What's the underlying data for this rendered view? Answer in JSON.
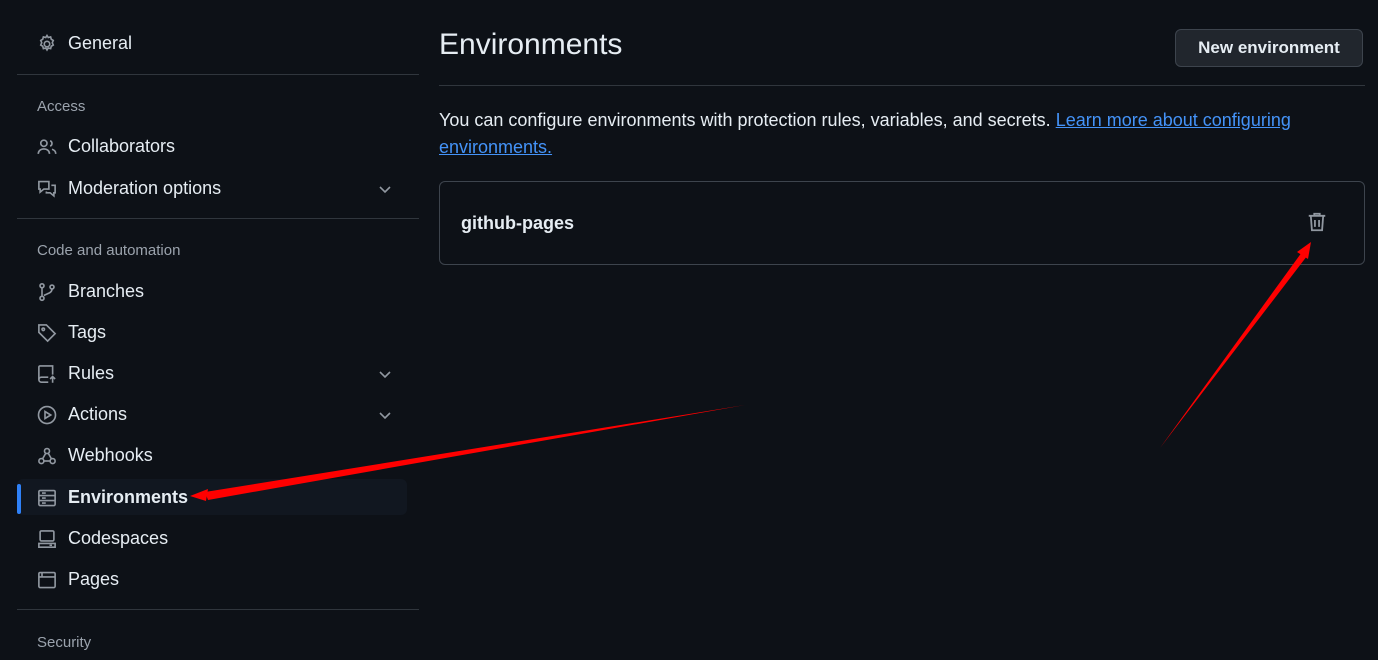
{
  "sidebar": {
    "general": "General",
    "sections": {
      "access": "Access",
      "code_automation": "Code and automation",
      "security": "Security"
    },
    "items": {
      "collaborators": "Collaborators",
      "moderation": "Moderation options",
      "branches": "Branches",
      "tags": "Tags",
      "rules": "Rules",
      "actions": "Actions",
      "webhooks": "Webhooks",
      "environments": "Environments",
      "codespaces": "Codespaces",
      "pages": "Pages"
    },
    "active_item": "Environments"
  },
  "main": {
    "title": "Environments",
    "new_button": "New environment",
    "description": "You can configure environments with protection rules, variables, and secrets.",
    "learn_more_link": "Learn more about configuring environments.",
    "environments": [
      {
        "name": "github-pages"
      }
    ]
  },
  "icons": {
    "general": "gear-icon",
    "collaborators": "people-icon",
    "moderation": "comment-discussion-icon",
    "branches": "git-branch-icon",
    "tags": "tag-icon",
    "rules": "repo-push-icon",
    "actions": "play-icon",
    "webhooks": "webhook-icon",
    "environments": "server-icon",
    "codespaces": "codespaces-icon",
    "pages": "browser-icon",
    "delete": "trash-icon",
    "expand": "chevron-down-icon"
  },
  "colors": {
    "background": "#0d1117",
    "border": "#30363d",
    "link": "#4493f8",
    "active_indicator": "#2f81f7",
    "annotation_arrow": "#ff0000"
  }
}
